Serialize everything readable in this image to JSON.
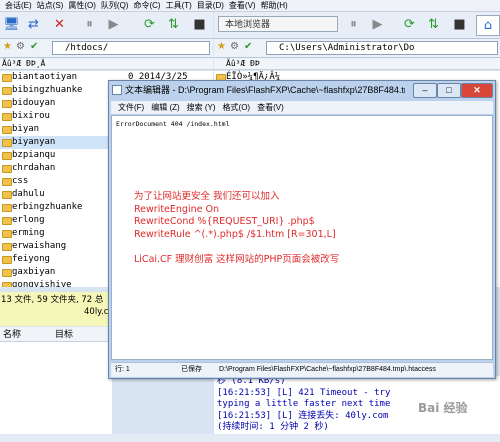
{
  "menubar": [
    "会话(E)",
    "站点(S)",
    "属性(O)",
    "队列(Q)",
    "命令(C)",
    "工具(T)",
    "目录(D)",
    "查看(V)",
    "帮助(H)"
  ],
  "local_browser": "本地浏览器",
  "left_path": "/htdocs/",
  "right_path": "C:\\Users\\Administrator\\Do",
  "left_header": "Ãû³Æ                     ÐÞ¸Ä",
  "right_header": "Ãû³Æ                           ÐÞ",
  "files": [
    {
      "name": "biantaotiyan",
      "extra": "  0  2014/3/25"
    },
    {
      "name": "bibingzhuanke",
      "extra": ""
    },
    {
      "name": "bidouyan",
      "extra": ""
    },
    {
      "name": "bixirou",
      "extra": ""
    },
    {
      "name": "biyan",
      "extra": ""
    },
    {
      "name": "biyanyan",
      "extra": ""
    },
    {
      "name": "bzpianqu",
      "extra": ""
    },
    {
      "name": "chrdahan",
      "extra": ""
    },
    {
      "name": "css",
      "extra": ""
    },
    {
      "name": "dahulu",
      "extra": ""
    },
    {
      "name": "erbingzhuanke",
      "extra": ""
    },
    {
      "name": "erlong",
      "extra": ""
    },
    {
      "name": "erming",
      "extra": ""
    },
    {
      "name": "erwaishang",
      "extra": ""
    },
    {
      "name": "feiyong",
      "extra": ""
    },
    {
      "name": "gaxbiyan",
      "extra": ""
    },
    {
      "name": "gongyishiye",
      "extra": ""
    }
  ],
  "right_up_row": "ÉÏÒ»¼¶Ä¿Â¼",
  "status": {
    "line1": "13 文件, 59 文件夹, 72 总",
    "line2": "40ly.c"
  },
  "queue": {
    "col_name": "名称",
    "col_target": "目标"
  },
  "log_lines": [
    "秒 (8.1 KB/s)",
    "[16:21:53] [L] 421 Timeout - try",
    "typing a little faster next time",
    "[16:21:53] [L] 连接丢失: 40ly.com",
    "(持续时间: 1 分钟 2 秒)"
  ],
  "editor": {
    "title": "文本编辑器 - D:\\Program Files\\FlashFXP\\Cache\\~flashfxp\\27B8F484.tmp\\.htaccess",
    "menu": [
      "文件(F)",
      "编辑 (Z)",
      "搜索 (Y)",
      "格式(O)",
      "查看(V)"
    ],
    "line1": "ErrorDocument 404 /index.html",
    "overlay": [
      "为了让网站更安全 我们还可以加入",
      "RewriteEngine On",
      "RewriteCond %{REQUEST_URI} .php$",
      "RewriteRule ^(.*).php$ /$1.htm [R=301,L]",
      "",
      "LiCai.CF 理财创富 这样网站的PHP页面会被改写"
    ],
    "status": {
      "pos": "行: 1",
      "state": "已保存",
      "path": "D:\\Program Files\\FlashFXP\\Cache\\~flashfxp\\27B8F484.tmp\\.htaccess"
    }
  },
  "watermark": "Bai 经验"
}
